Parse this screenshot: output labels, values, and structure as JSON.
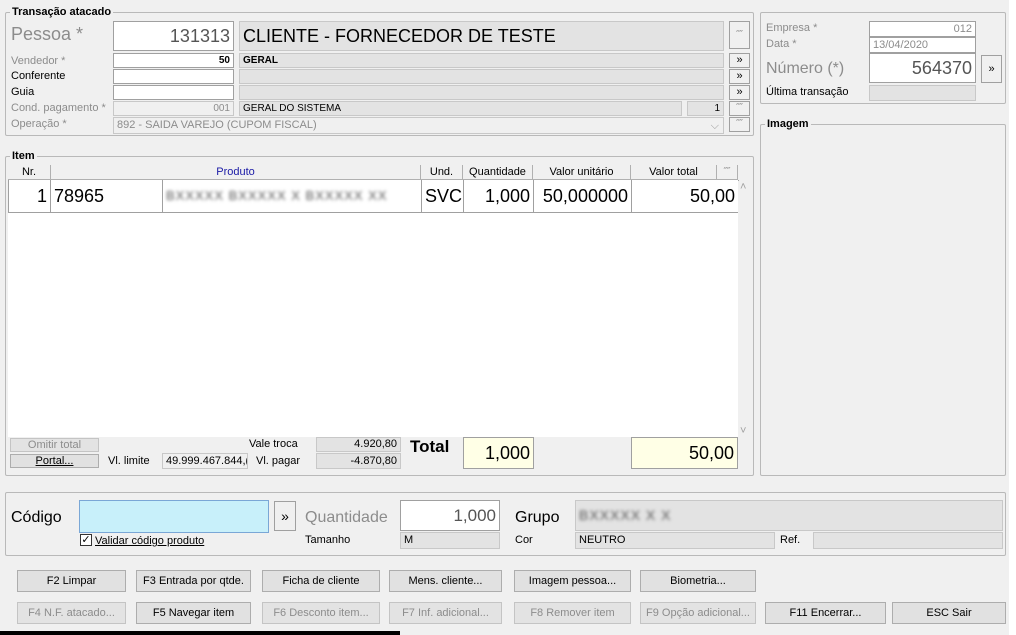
{
  "transacao": {
    "title": "Transação atacado",
    "pessoa_label": "Pessoa *",
    "pessoa_code": "131313",
    "pessoa_name": "CLIENTE - FORNECEDOR DE TESTE",
    "vendedor_label": "Vendedor *",
    "vendedor_code": "50",
    "vendedor_name": "GERAL",
    "conferente_label": "Conferente",
    "conferente_value": "",
    "guia_label": "Guia",
    "guia_value": "",
    "cond_label": "Cond. pagamento *",
    "cond_code": "001",
    "cond_name": "GERAL DO SISTEMA",
    "cond_num": "1",
    "operacao_label": "Operação *",
    "operacao_value": "892 - SAIDA VAREJO (CUPOM FISCAL)"
  },
  "empresa": {
    "empresa_label": "Empresa *",
    "empresa_value": "012",
    "data_label": "Data *",
    "data_value": "13/04/2020",
    "numero_label": "Número (*)",
    "numero_value": "564370",
    "ultima_label": "Última transação",
    "ultima_value": ""
  },
  "imagem": {
    "title": "Imagem"
  },
  "item": {
    "title": "Item",
    "columns": [
      "Nr.",
      "Produto",
      "Und.",
      "Quantidade",
      "Valor unitário",
      "Valor total"
    ],
    "rows": [
      {
        "nr": "1",
        "codigo": "78965",
        "descricao": "BXXXXX BXXXXX X BXXXXX XX",
        "und": "SVC",
        "qtd": "1,000",
        "unit": "50,000000",
        "total": "50,00"
      }
    ],
    "omitir_label": "Omitir total",
    "portal_label": "Portal...",
    "vl_limite_label": "Vl. limite",
    "vl_limite_value": "49.999.467.844,(",
    "vale_troca_label": "Vale troca",
    "vale_troca_value": "4.920,80",
    "vl_pagar_label": "Vl. pagar",
    "vl_pagar_value": "-4.870,80",
    "total_label": "Total",
    "total_qtd": "1,000",
    "total_valor": "50,00"
  },
  "entrada": {
    "codigo_label": "Código",
    "codigo_value": "",
    "validar_label": "Validar código produto",
    "validar_checked": "✓",
    "quantidade_label": "Quantidade",
    "quantidade_value": "1,000",
    "tamanho_label": "Tamanho",
    "tamanho_value": "M",
    "grupo_label": "Grupo",
    "grupo_value": "BXXXXX X X",
    "cor_label": "Cor",
    "cor_value": "NEUTRO",
    "ref_label": "Ref.",
    "ref_value": ""
  },
  "buttons": {
    "f2": "F2 Limpar",
    "f3": "F3 Entrada por qtde.",
    "ficha": "Ficha de cliente",
    "mens": "Mens. cliente...",
    "imagem": "Imagem pessoa...",
    "biometria": "Biometria...",
    "f4": "F4 N.F. atacado...",
    "f5": "F5 Navegar item",
    "f6": "F6 Desconto item...",
    "f7": "F7 Inf. adicional...",
    "f8": "F8 Remover item",
    "f9": "F9 Opção adicional...",
    "f11": "F11 Encerrar...",
    "esc": "ESC Sair"
  },
  "icons": {
    "more": "»",
    "pin": "⁗",
    "scroll_up": "˄",
    "scroll_down": "˅",
    "dropdown": "⌵"
  },
  "colors": {
    "highlight_input": "#c8f0fa",
    "total_bg": "#ffffe6",
    "panel_bg": "#f0f0f0"
  }
}
